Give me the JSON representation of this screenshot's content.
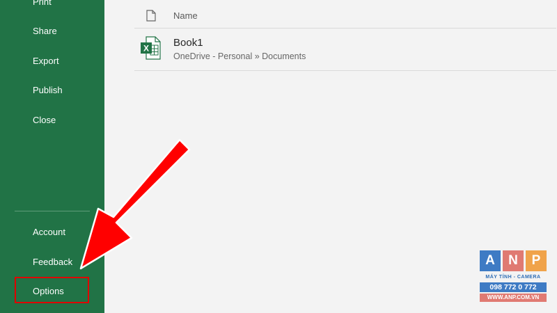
{
  "sidebar": {
    "items": [
      {
        "label": "Print"
      },
      {
        "label": "Share"
      },
      {
        "label": "Export"
      },
      {
        "label": "Publish"
      },
      {
        "label": "Close"
      }
    ],
    "bottom_items": [
      {
        "label": "Account"
      },
      {
        "label": "Feedback"
      },
      {
        "label": "Options"
      }
    ],
    "highlighted_item": "Options"
  },
  "file_list": {
    "column_name": "Name",
    "files": [
      {
        "name": "Book1",
        "path": "OneDrive - Personal » Documents",
        "icon": "excel-file-icon"
      }
    ]
  },
  "annotation": {
    "color": "#ff0000",
    "type": "arrow pointing to Options"
  },
  "watermark": {
    "letters": [
      "A",
      "N",
      "P"
    ],
    "subtitle": "MÁY TÍNH - CAMERA",
    "phone": "098 772 0 772",
    "website": "WWW.ANP.COM.VN"
  },
  "colors": {
    "sidebar_bg": "#217346",
    "main_bg": "#f3f3f3",
    "highlight_border": "#e00000"
  }
}
